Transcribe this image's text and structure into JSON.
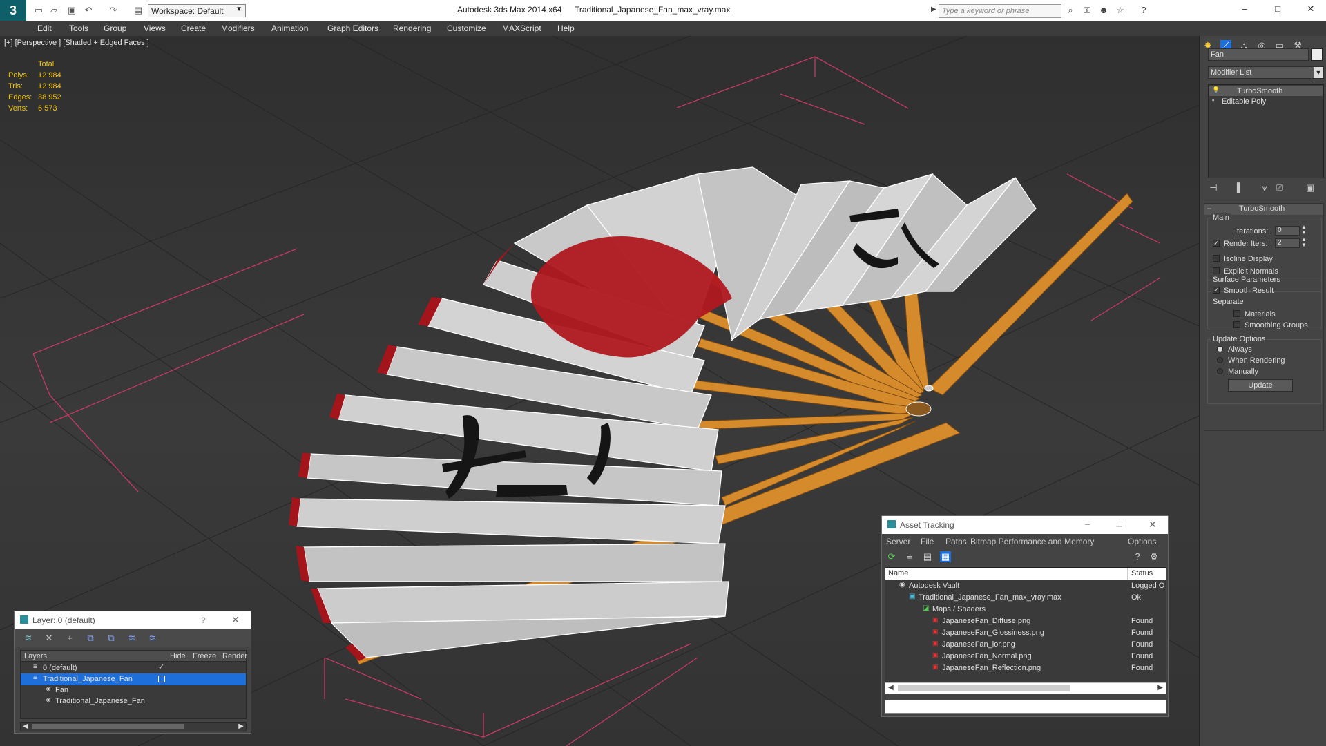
{
  "titlebar": {
    "workspace": "Workspace: Default",
    "app_title": "Autodesk 3ds Max  2014 x64",
    "file_name": "Traditional_Japanese_Fan_max_vray.max",
    "search_placeholder": "Type a keyword or phrase"
  },
  "menu": [
    "Edit",
    "Tools",
    "Group",
    "Views",
    "Create",
    "Modifiers",
    "Animation",
    "Graph Editors",
    "Rendering",
    "Customize",
    "MAXScript",
    "Help"
  ],
  "viewport": {
    "label": "[+] [Perspective ] [Shaded + Edged Faces ]",
    "stats": {
      "total_label": "Total",
      "polys_label": "Polys:",
      "polys": "12 984",
      "tris_label": "Tris:",
      "tris": "12 984",
      "edges_label": "Edges:",
      "edges": "38 952",
      "verts_label": "Verts:",
      "verts": "6 573"
    }
  },
  "command_panel": {
    "object_name": "Fan",
    "modifier_list": "Modifier List",
    "stack": [
      "TurboSmooth",
      "Editable Poly"
    ],
    "rollout_title": "TurboSmooth",
    "main_label": "Main",
    "iterations_label": "Iterations:",
    "iterations": "0",
    "render_iters_label": "Render Iters:",
    "render_iters": "2",
    "render_iters_checked": true,
    "isoline_label": "Isoline Display",
    "explicit_normals_label": "Explicit Normals",
    "surface_params_label": "Surface Parameters",
    "smooth_result_label": "Smooth Result",
    "separate_label": "Separate",
    "materials_label": "Materials",
    "smoothing_groups_label": "Smoothing Groups",
    "update_options_label": "Update Options",
    "always_label": "Always",
    "when_rendering_label": "When Rendering",
    "manually_label": "Manually",
    "update_button": "Update"
  },
  "layer_window": {
    "title": "Layer: 0 (default)",
    "help": "?",
    "col_layers": "Layers",
    "col_hide": "Hide",
    "col_freeze": "Freeze",
    "col_render": "Render",
    "rows": [
      {
        "name": "0 (default)"
      },
      {
        "name": "Traditional_Japanese_Fan"
      },
      {
        "name": "Fan"
      },
      {
        "name": "Traditional_Japanese_Fan"
      }
    ]
  },
  "asset_window": {
    "title": "Asset Tracking",
    "menu": [
      "Server",
      "File",
      "Paths",
      "Bitmap Performance and Memory",
      "Options"
    ],
    "col_name": "Name",
    "col_status": "Status",
    "rows": [
      {
        "name": "Autodesk Vault",
        "status": "Logged O"
      },
      {
        "name": "Traditional_Japanese_Fan_max_vray.max",
        "status": "Ok"
      },
      {
        "name": "Maps / Shaders",
        "status": ""
      },
      {
        "name": "JapaneseFan_Diffuse.png",
        "status": "Found"
      },
      {
        "name": "JapaneseFan_Glossiness.png",
        "status": "Found"
      },
      {
        "name": "JapaneseFan_ior.png",
        "status": "Found"
      },
      {
        "name": "JapaneseFan_Normal.png",
        "status": "Found"
      },
      {
        "name": "JapaneseFan_Reflection.png",
        "status": "Found"
      }
    ]
  },
  "colors": {
    "stats_yellow": "#f1c40f",
    "selection_blue": "#1e6fd9",
    "fan_red": "#a3141b",
    "bamboo": "#d58a2c"
  }
}
